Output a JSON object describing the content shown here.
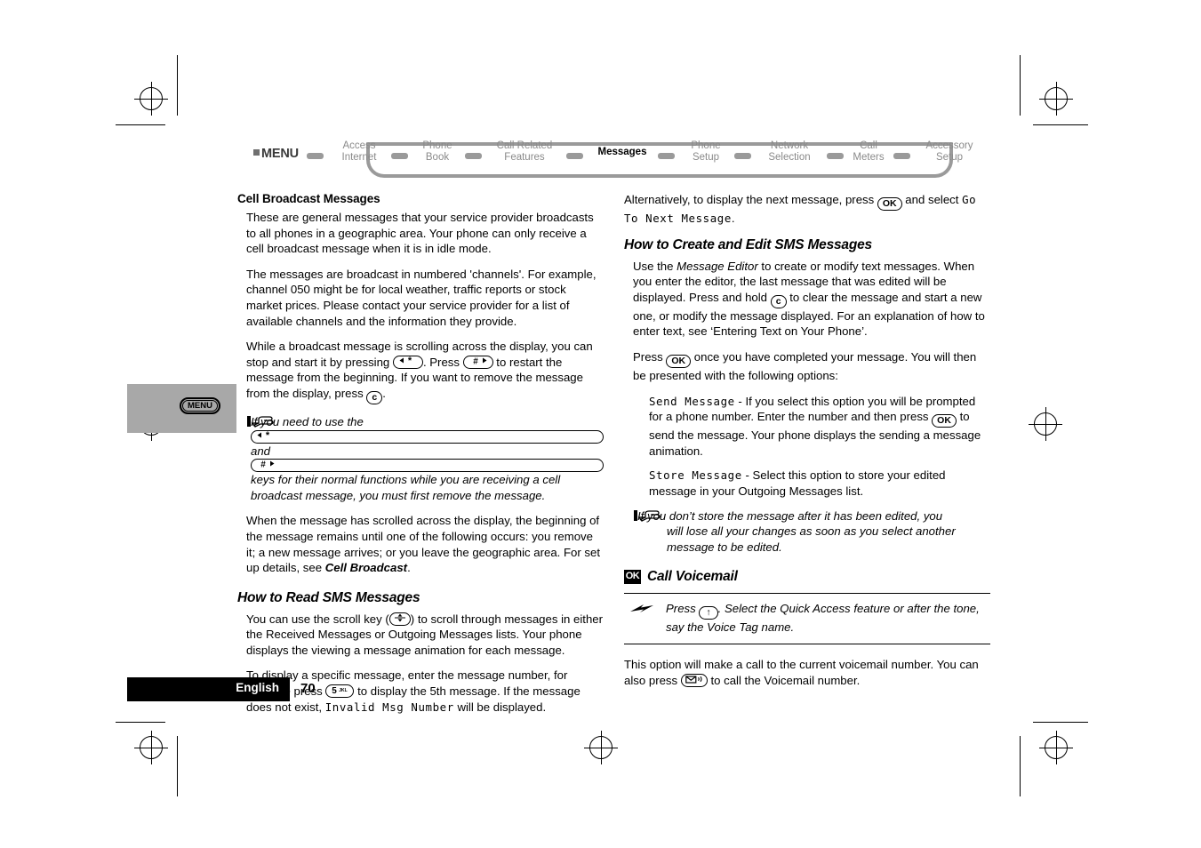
{
  "nav": {
    "menu_label": "MENU",
    "items": [
      {
        "label": "Access\nInternet",
        "active": false
      },
      {
        "label": "Phone\nBook",
        "active": false
      },
      {
        "label": "Call Related\nFeatures",
        "active": false
      },
      {
        "label": "Messages",
        "active": true
      },
      {
        "label": "Phone\nSetup",
        "active": false
      },
      {
        "label": "Network\nSelection",
        "active": false
      },
      {
        "label": "Call\nMeters",
        "active": false
      },
      {
        "label": "Accessory\nSetup",
        "active": false
      }
    ]
  },
  "left_column": {
    "heading": "Cell Broadcast Messages",
    "para1": "These are general messages that your service provider broadcasts to all phones in a geographic area. Your phone can only receive a cell broadcast message when it is in idle mode.",
    "para2": "The messages are broadcast in numbered 'channels'. For example, channel 050 might be for local weather, traffic reports or stock market prices. Please contact your service provider for a list of available channels and the information they provide.",
    "para3_a": "While a broadcast message is scrolling across the display, you can stop and start it by pressing ",
    "para3_b": ". Press ",
    "para3_c": " to restart the message from the beginning. If you want to remove the message from the display, press ",
    "para3_d": ".",
    "note1_a": "If you need to use the ",
    "note1_b": " and ",
    "note1_c": " keys for their normal functions while you are receiving a cell broadcast message, you must first remove the message.",
    "para4_a": "When the message has scrolled across the display, the beginning of the message remains until one of the following occurs: you remove it; a new message arrives; or you leave the geographic area. For set up details, see ",
    "para4_bold": "Cell Broadcast",
    "para4_end": ".",
    "section2_heading": "How to Read SMS Messages",
    "para5_a": "You can use the scroll key (",
    "para5_b": ") to scroll through messages in either the Received Messages or Outgoing Messages lists. Your phone displays the viewing a message animation for each message.",
    "para6_a": "To display a specific message, enter the message number, for example press ",
    "para6_b": " to display the 5th message. If the message does not exist, ",
    "para6_lcd": "Invalid Msg Number",
    "para6_c": " will be displayed.",
    "menu_tab_key": "MENU"
  },
  "right_column": {
    "para1_a": "Alternatively, to display the next message, press ",
    "para1_b": " and select ",
    "para1_lcd": "Go To Next Message",
    "para1_c": ".",
    "section_heading": "How to Create and Edit SMS Messages",
    "para2_a": "Use the ",
    "para2_italic": "Message Editor",
    "para2_b": " to create or modify text messages. When you enter the editor, the last message that was edited will be displayed. Press and hold ",
    "para2_c": " to clear the message and start a new one, or modify the message displayed. For an explanation of how to enter text, see ‘Entering Text on Your Phone’.",
    "para3_a": "Press ",
    "para3_b": " once you have completed your message. You will then be presented with the following options:",
    "option1_lcd": "Send Message",
    "option1_a": " - If you select this option you will be prompted for a phone number. Enter the number and then press ",
    "option1_b": " to send the message. Your phone displays the sending a message animation.",
    "option2_lcd": "Store Message",
    "option2_a": " - Select this option to store your edited message in your Outgoing Messages list.",
    "note_a": "If you don’t store the message after it has been edited, you",
    "note_b": "will lose all your changes as soon as you select another message to be edited.",
    "voicemail_badge": "OK",
    "voicemail_heading": "Call Voicemail",
    "quick_access_a": "Press ",
    "quick_access_b": ". Select the Quick Access feature or after the tone, say the Voice Tag name.",
    "para4_a": "This option will make a call to the current voicemail number. You can also press ",
    "para4_b": " to call the Voicemail number."
  },
  "keys": {
    "ok": "OK",
    "clear": "c",
    "star": "star-key",
    "hash": "hash-key",
    "five": "5",
    "five_letters": "JKL",
    "scroll": "scroll-key",
    "up_arrow": "↑",
    "voicemail": "voicemail-key"
  },
  "footer": {
    "language": "English",
    "page_number": "70"
  },
  "colors": {
    "nav_inactive": "#8a8a8a",
    "nav_track": "#9a9a9a",
    "menu_tab_bg": "#a8a8a8",
    "footer_bg": "#000000",
    "text": "#000000"
  }
}
